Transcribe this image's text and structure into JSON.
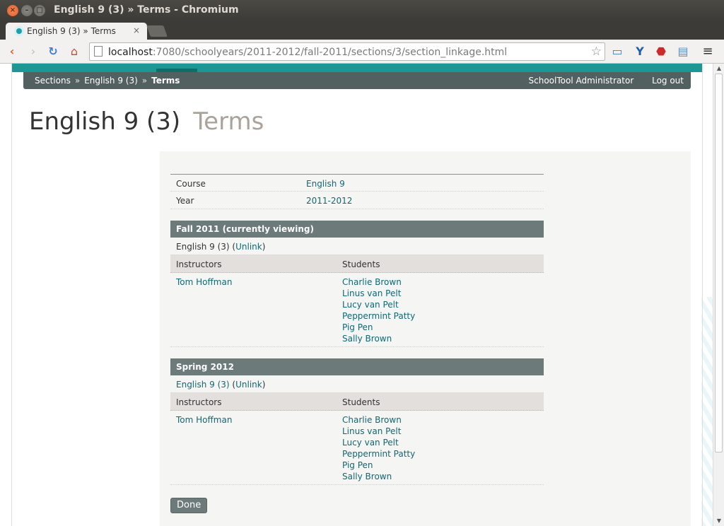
{
  "window": {
    "title": "English 9 (3) » Terms - Chromium"
  },
  "tab": {
    "title": "English 9 (3) » Terms",
    "close": "×"
  },
  "address": {
    "host": "localhost",
    "path": ":7080/schoolyears/2011-2012/fall-2011/sections/3/section_linkage.html"
  },
  "icons": {
    "back": "back-icon",
    "forward": "forward-icon",
    "reload": "reload-icon",
    "home": "home-icon",
    "star": "star-icon",
    "menu": "menu-icon"
  },
  "colors": {
    "accent": "#1a9896",
    "navbar": "#536060",
    "link": "#0c6a74",
    "header": "#6c7a7a"
  },
  "nav": {
    "crumbs": [
      "Sections",
      "English 9 (3)",
      "Terms"
    ],
    "separator": "»",
    "user": "SchoolTool Administrator",
    "logout": "Log out"
  },
  "page": {
    "title": "English 9 (3)",
    "subtitle": "Terms"
  },
  "info": {
    "course_label": "Course",
    "course_value": "English 9",
    "year_label": "Year",
    "year_value": "2011-2012"
  },
  "columns": {
    "instructors": "Instructors",
    "students": "Students"
  },
  "terms": [
    {
      "header": "Fall 2011 (currently viewing)",
      "section": "English 9 (3)",
      "unlink": "Unlink",
      "instructor": "Tom Hoffman",
      "students": [
        "Charlie Brown",
        "Linus van Pelt",
        "Lucy van Pelt",
        "Peppermint Patty",
        "Pig Pen",
        "Sally Brown"
      ]
    },
    {
      "header": "Spring 2012",
      "section": "English 9 (3)",
      "unlink": "Unlink",
      "instructor": "Tom Hoffman",
      "students": [
        "Charlie Brown",
        "Linus van Pelt",
        "Lucy van Pelt",
        "Peppermint Patty",
        "Pig Pen",
        "Sally Brown"
      ]
    }
  ],
  "done_label": "Done"
}
